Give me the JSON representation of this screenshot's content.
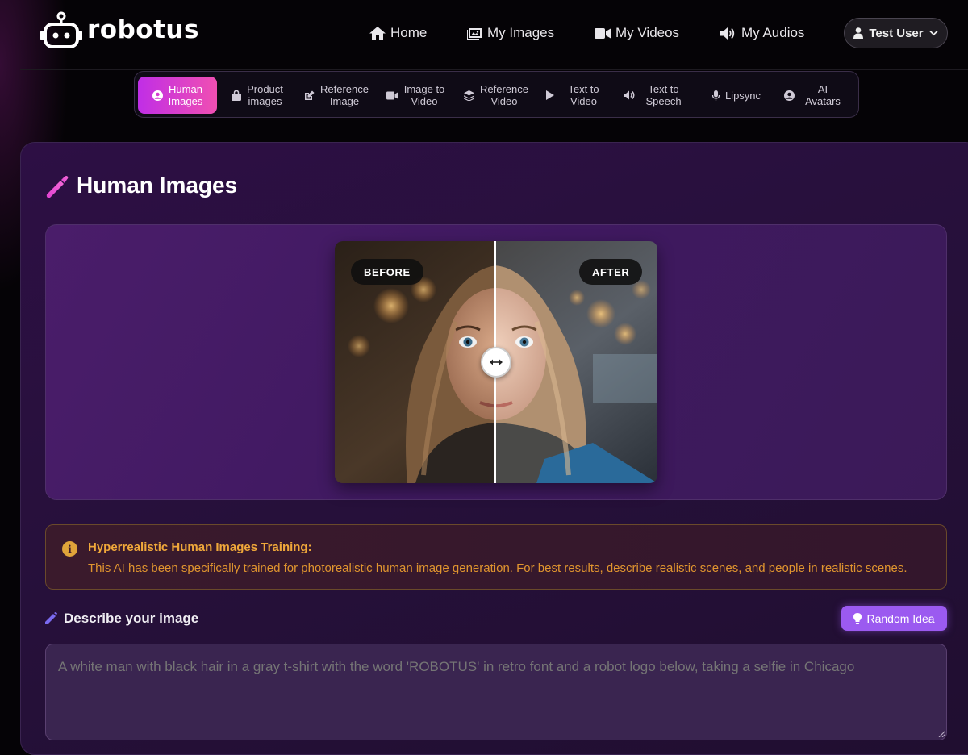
{
  "brand": {
    "name": "robotus"
  },
  "topnav": {
    "items": [
      {
        "label": "Home",
        "icon": "home-icon"
      },
      {
        "label": "My Images",
        "icon": "images-icon"
      },
      {
        "label": "My Videos",
        "icon": "video-icon"
      },
      {
        "label": "My Audios",
        "icon": "audio-icon"
      }
    ],
    "user": {
      "label": "Test User",
      "icon": "user-icon"
    }
  },
  "tools": {
    "active": "Human Images",
    "items": [
      {
        "line1": "Human",
        "line2": "Images",
        "icon": "user-circle-icon"
      },
      {
        "line1": "Product",
        "line2": "images",
        "icon": "bag-icon"
      },
      {
        "line1": "Reference",
        "line2": "Image",
        "icon": "edit-icon"
      },
      {
        "line1": "Image to",
        "line2": "Video",
        "icon": "video-icon"
      },
      {
        "line1": "Reference",
        "line2": "Video",
        "icon": "layers-icon"
      },
      {
        "line1": "Text to",
        "line2": "Video",
        "icon": "play-icon"
      },
      {
        "line1": "Text to",
        "line2": "Speech",
        "icon": "speaker-icon"
      },
      {
        "line1": "Lipsync",
        "line2": "",
        "icon": "microphone-icon"
      },
      {
        "line1": "AI",
        "line2": "Avatars",
        "icon": "user-circle-icon"
      }
    ]
  },
  "page": {
    "title": "Human Images",
    "icon": "brush-icon"
  },
  "preview": {
    "before_label": "BEFORE",
    "after_label": "AFTER"
  },
  "alert": {
    "title": "Hyperrealistic Human Images Training:",
    "text": "This AI has been specifically trained for photorealistic human image generation. For best results, describe realistic scenes, and people in realistic scenes."
  },
  "describe": {
    "label": "Describe your image",
    "random_button": "Random Idea",
    "placeholder": "A white man with black hair in a gray t-shirt with the word 'ROBOTUS' in retro font and a robot logo below, taking a selfie in Chicago"
  },
  "colors": {
    "accent_gradient_start": "#c02ee6",
    "accent_gradient_end": "#f04fb2",
    "random_button": "#9b5af0",
    "alert_text": "#e0952f"
  }
}
